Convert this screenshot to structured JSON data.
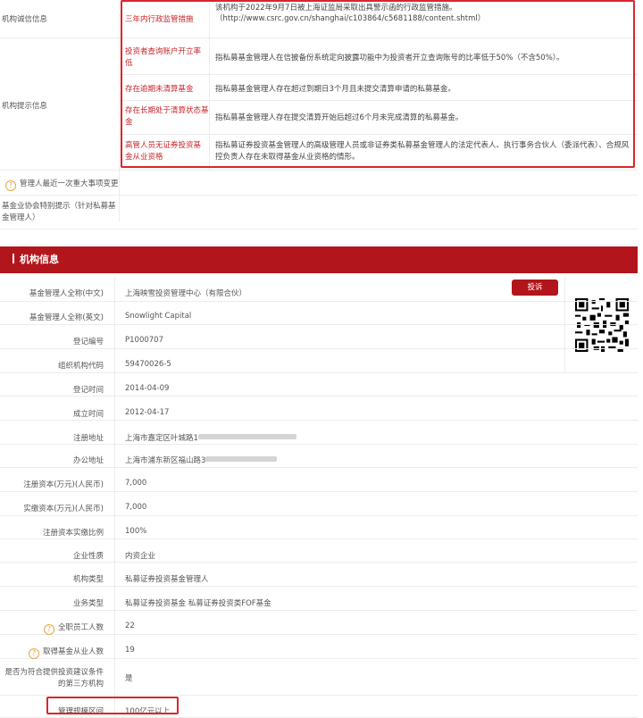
{
  "top": {
    "credit_label": "机构诚信信息",
    "credit_item_label": "三年内行政监管措施",
    "credit_item_value": "该机构于2022年9月7日被上海证监局采取出具警示函的行政监管措施。（http://www.csrc.gov.cn/shanghai/c103864/c5681188/content.shtml）",
    "hint_label": "机构提示信息",
    "hints": [
      {
        "label": "投资者查询账户开立率低",
        "value": "指私募基金管理人在信披备份系统定向披露功能中为投资者开立查询账号的比率低于50%（不含50%）。"
      },
      {
        "label": "存在逾期未清算基金",
        "value": "指私募基金管理人存在超过到期日3个月且未提交清算申请的私募基金。"
      },
      {
        "label": "存在长期处于清算状态基金",
        "value": "指私募基金管理人存在提交清算开始后超过6个月未完成清算的私募基金。"
      },
      {
        "label": "高管人员无证券投资基金从业资格",
        "value": "指私募证券投资基金管理人的高级管理人员或非证券类私募基金管理人的法定代表人、执行事务合伙人（委派代表）、合规风控负责人存在未取得基金从业资格的情形。"
      }
    ],
    "recent_change_label": "管理人最近一次重大事项变更",
    "assoc_label": "基金业协会特别提示（针对私募基金管理人）"
  },
  "section": {
    "title": "机构信息",
    "complain_label": "投诉"
  },
  "rows": [
    {
      "label": "基金管理人全称(中文)",
      "value": "上海映雪投资管理中心（有限合伙）"
    },
    {
      "label": "基金管理人全称(英文)",
      "value": "Snowlight Capital"
    },
    {
      "label": "登记编号",
      "value": "P1000707"
    },
    {
      "label": "组织机构代码",
      "value": "59470026-5"
    },
    {
      "label": "登记时间",
      "value": "2014-04-09"
    },
    {
      "label": "成立时间",
      "value": "2012-04-17"
    },
    {
      "label": "注册地址",
      "value": "上海市嘉定区叶城路1"
    },
    {
      "label": "办公地址",
      "value": "上海市浦东新区福山路3"
    },
    {
      "label": "注册资本(万元)(人民币)",
      "value": "7,000"
    },
    {
      "label": "实缴资本(万元)(人民币)",
      "value": "7,000"
    },
    {
      "label": "注册资本实缴比例",
      "value": "100%"
    },
    {
      "label": "企业性质",
      "value": "内资企业"
    },
    {
      "label": "机构类型",
      "value": "私募证券投资基金管理人"
    },
    {
      "label": "业务类型",
      "value": "私募证券投资基金  私募证券投资类FOF基金"
    },
    {
      "label": "全职员工人数",
      "value": "22"
    },
    {
      "label": "取得基金从业人数",
      "value": "19"
    },
    {
      "label": "是否为符合提供投资建议条件的第三方机构",
      "value": "是"
    },
    {
      "label": "管理规模区间",
      "value": "100亿元以上"
    }
  ],
  "colors": {
    "accent": "#b2161c",
    "highlight": "#d9262b",
    "label_red": "#c9252b"
  }
}
